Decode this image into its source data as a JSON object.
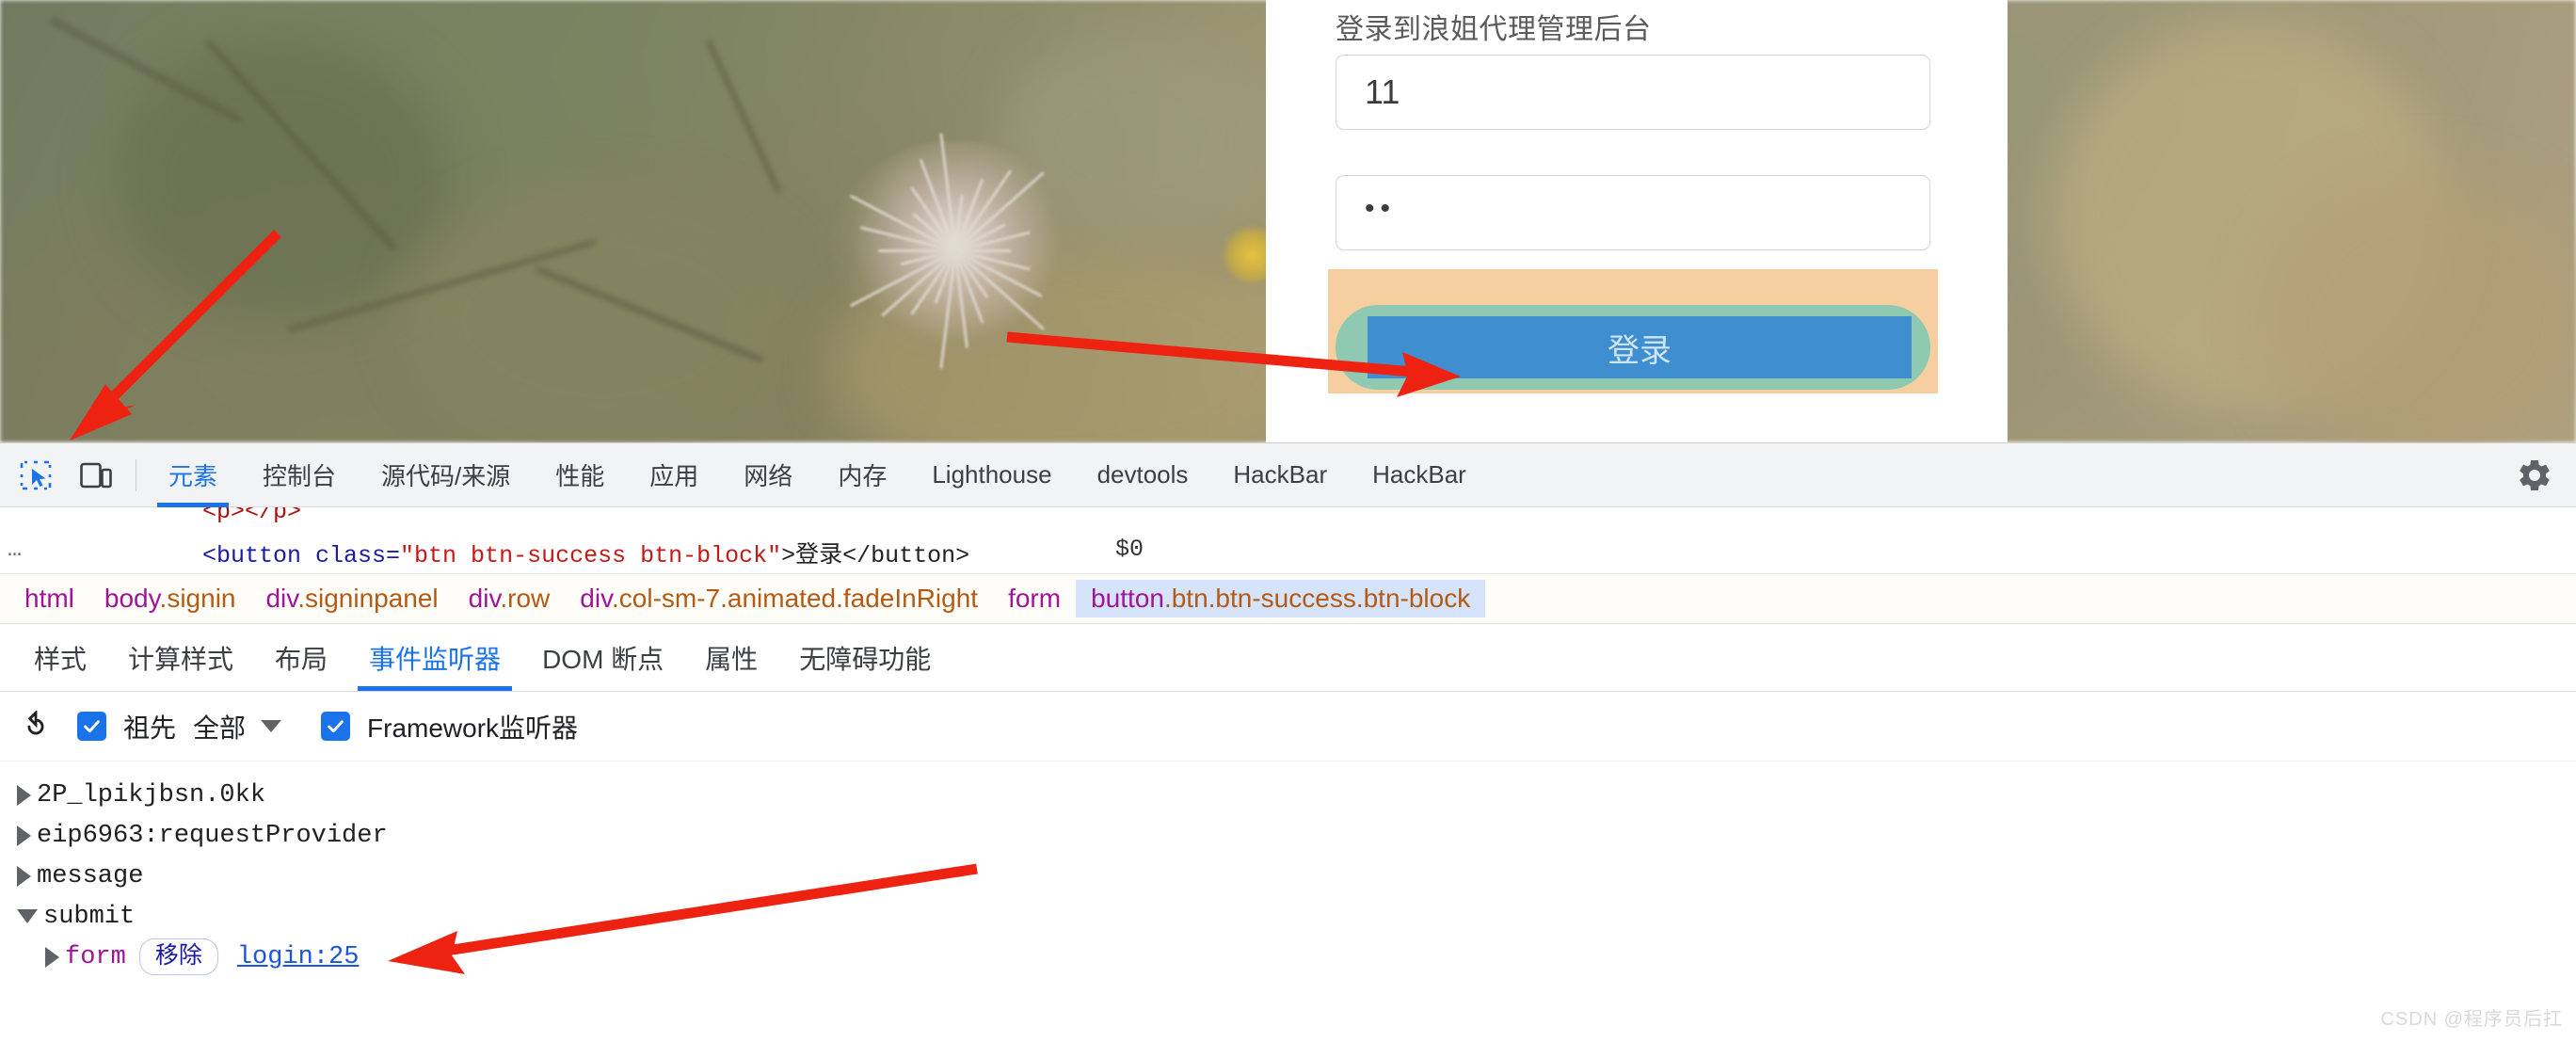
{
  "page": {
    "login": {
      "title": "登录到浪姐代理管理后台",
      "username_value": "11",
      "password_value": "••",
      "submit_label": "登录",
      "highlight_colors": {
        "margin": "#f6cfa1",
        "padding": "#8fc9b2",
        "content": "#3f8fd0"
      }
    }
  },
  "devtools": {
    "toolbar": {
      "inspect_icon": "inspect-element-icon",
      "device_icon": "device-toolbar-icon",
      "settings_icon": "gear-icon",
      "tabs": [
        {
          "label": "元素",
          "active": true
        },
        {
          "label": "控制台",
          "active": false
        },
        {
          "label": "源代码/来源",
          "active": false
        },
        {
          "label": "性能",
          "active": false
        },
        {
          "label": "应用",
          "active": false
        },
        {
          "label": "网络",
          "active": false
        },
        {
          "label": "内存",
          "active": false
        },
        {
          "label": "Lighthouse",
          "active": false
        },
        {
          "label": "devtools",
          "active": false
        },
        {
          "label": "HackBar",
          "active": false
        },
        {
          "label": "HackBar",
          "active": false
        }
      ]
    },
    "dom_snippet": {
      "dots": "…",
      "line1": "<p></p>",
      "line2_open": "<button class=",
      "line2_value": "\"btn btn-success btn-block\"",
      "line2_close": ">登录</button>",
      "scroll_marker": "$0"
    },
    "breadcrumb": [
      {
        "tag": "html",
        "cls": "",
        "selected": false
      },
      {
        "tag": "body",
        "cls": ".signin",
        "selected": false
      },
      {
        "tag": "div",
        "cls": ".signinpanel",
        "selected": false
      },
      {
        "tag": "div",
        "cls": ".row",
        "selected": false
      },
      {
        "tag": "div",
        "cls": ".col-sm-7.animated.fadeInRight",
        "selected": false
      },
      {
        "tag": "form",
        "cls": "",
        "selected": false
      },
      {
        "tag": "button",
        "cls": ".btn.btn-success.btn-block",
        "selected": true
      }
    ],
    "subtabs": [
      {
        "label": "样式",
        "active": false
      },
      {
        "label": "计算样式",
        "active": false
      },
      {
        "label": "布局",
        "active": false
      },
      {
        "label": "事件监听器",
        "active": true
      },
      {
        "label": "DOM 断点",
        "active": false
      },
      {
        "label": "属性",
        "active": false
      },
      {
        "label": "无障碍功能",
        "active": false
      }
    ],
    "filterbar": {
      "refresh_icon": "refresh-icon",
      "ancestors_label": "祖先",
      "ancestors_checked": true,
      "scope_value": "全部",
      "framework_label": "Framework监听器",
      "framework_checked": true
    },
    "listeners": [
      {
        "name": "2P_lpikjbsn.0kk",
        "expanded": false,
        "children": []
      },
      {
        "name": "eip6963:requestProvider",
        "expanded": false,
        "children": []
      },
      {
        "name": "message",
        "expanded": false,
        "children": []
      },
      {
        "name": "submit",
        "expanded": true,
        "children": [
          {
            "node": "form",
            "remove_label": "移除",
            "source": "login:25"
          }
        ]
      }
    ]
  },
  "watermark": "CSDN @程序员后扛"
}
